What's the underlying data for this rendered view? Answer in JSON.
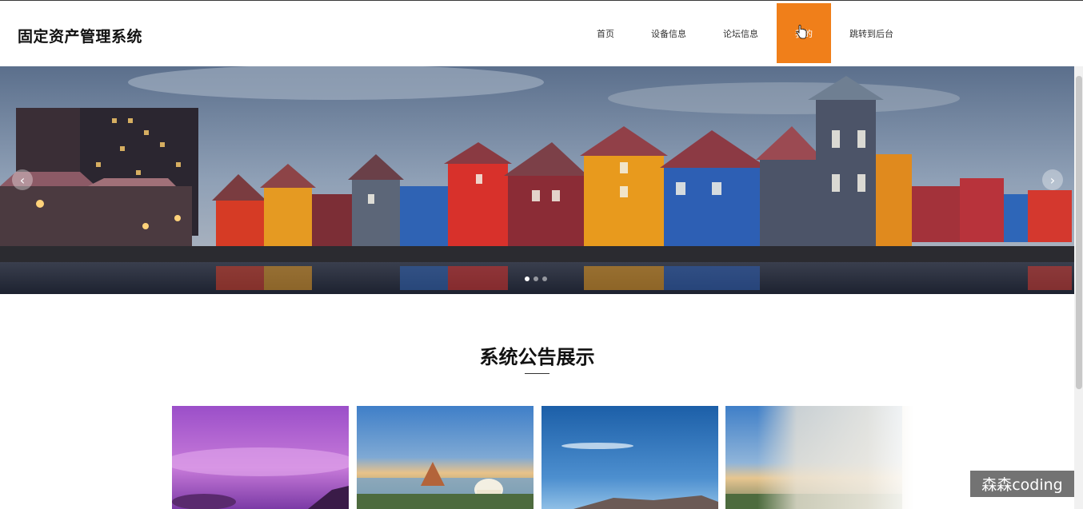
{
  "header": {
    "brand": "固定资产管理系统",
    "nav": [
      {
        "label": "首页"
      },
      {
        "label": "设备信息"
      },
      {
        "label": "论坛信息"
      },
      {
        "label": "我的"
      },
      {
        "label": "跳转到后台"
      }
    ],
    "active_nav": "我的",
    "accent_color": "#f07f1a"
  },
  "carousel": {
    "slide_count": 3,
    "active_slide": 1,
    "prev_icon": "chevron-left-icon",
    "next_icon": "chevron-right-icon"
  },
  "notice_section": {
    "title": "系统公告展示"
  },
  "watermark": "森森coding"
}
